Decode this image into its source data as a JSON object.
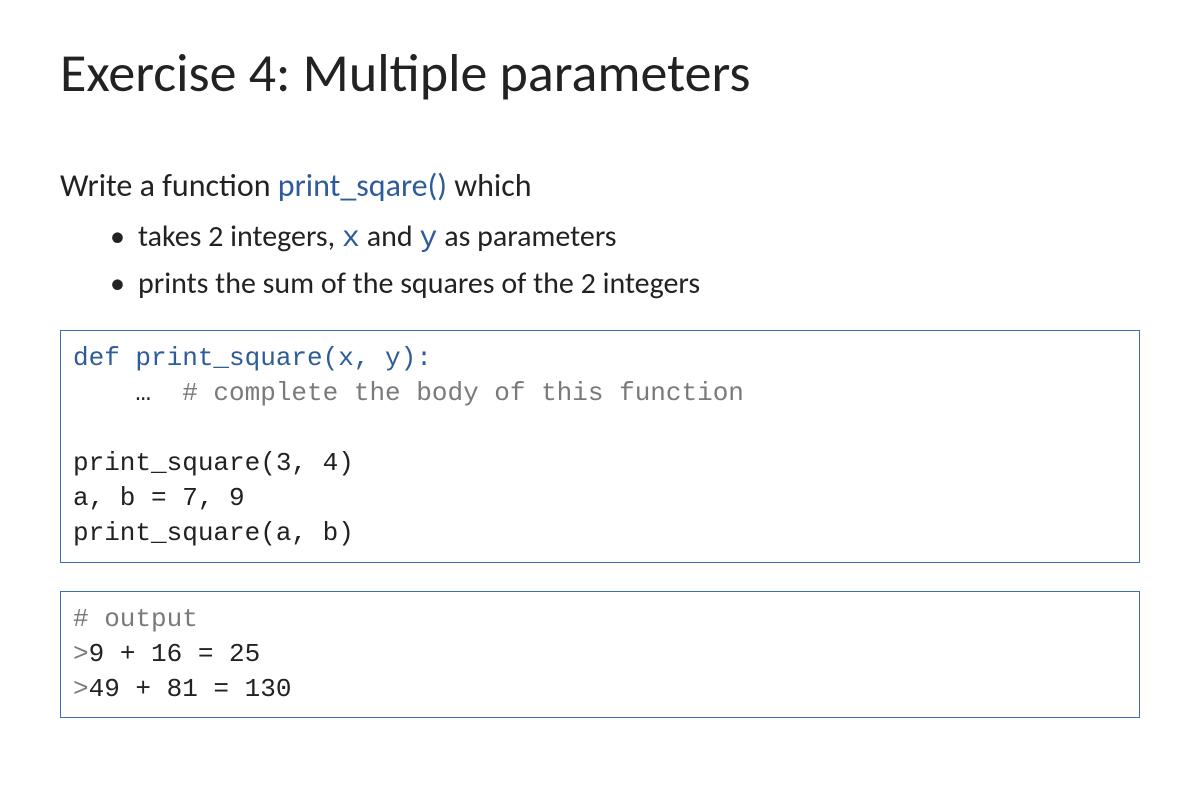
{
  "title": "Exercise 4: Multiple parameters",
  "intro": {
    "prefix": "Write a function ",
    "fn": "print_sqare()",
    "suffix": " which"
  },
  "bullets": {
    "b1": {
      "p1": "takes 2 integers, ",
      "x": "x",
      "p2": " and ",
      "y": "y",
      "p3": " as parameters"
    },
    "b2": "prints the sum of the squares of the 2 integers"
  },
  "code1": {
    "line1": "def print_square(x, y):",
    "line2_prefix": "    …  ",
    "line2_comment": "# complete the body of this function",
    "blank": "",
    "line3": "print_square(3, 4)",
    "line4": "a, b = 7, 9",
    "line5": "print_square(a, b)"
  },
  "code2": {
    "comment": "# output",
    "gt1": ">",
    "out1": "9 + 16 = 25",
    "gt2": ">",
    "out2": "49 + 81 = 130"
  }
}
